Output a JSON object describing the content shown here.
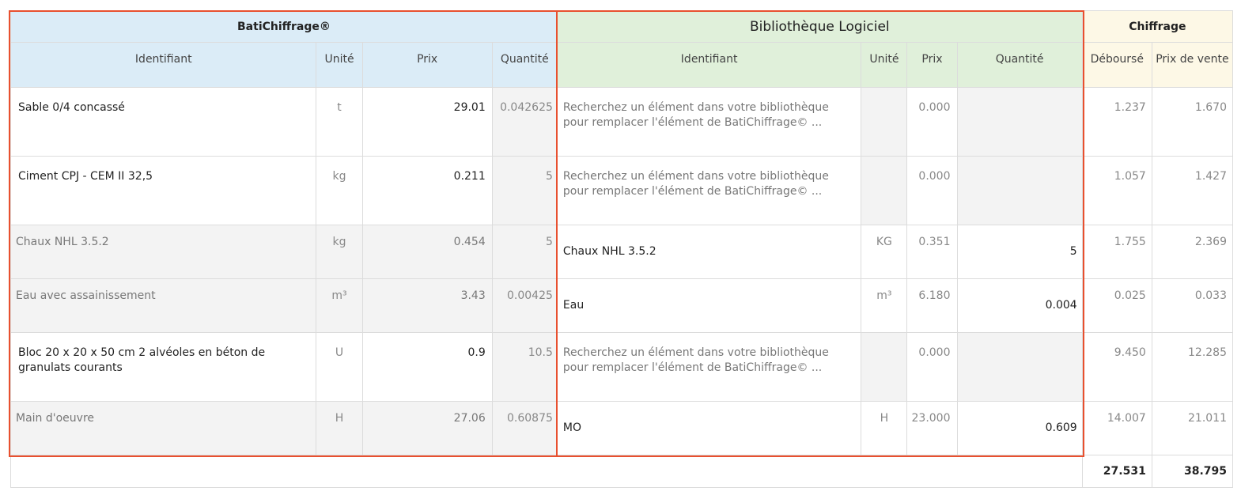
{
  "groups": {
    "bati": "BatiChiffrage®",
    "library": "Bibliothèque Logiciel",
    "chiffrage": "Chiffrage"
  },
  "headers": {
    "bati": [
      "Identifiant",
      "Unité",
      "Prix",
      "Quantité"
    ],
    "library": [
      "Identifiant",
      "Unité",
      "Prix",
      "Quantité"
    ],
    "chiffrage": [
      "Déboursé",
      "Prix de vente"
    ]
  },
  "rows": [
    {
      "bati": {
        "id": "Sable 0/4 concassé",
        "unit": "t",
        "price": "29.01",
        "qty": "0.042625"
      },
      "lib": {
        "id": "Recherchez un élément dans votre bibliothèque pour remplacer l'élément de BatiChiffrage© ...",
        "unit": "",
        "price": "0.000",
        "qty": ""
      },
      "debourse": "1.237",
      "prix_vente": "1.670"
    },
    {
      "bati": {
        "id": "Ciment CPJ - CEM II 32,5",
        "unit": "kg",
        "price": "0.211",
        "qty": "5"
      },
      "lib": {
        "id": "Recherchez un élément dans votre bibliothèque pour remplacer l'élément de BatiChiffrage© ...",
        "unit": "",
        "price": "0.000",
        "qty": ""
      },
      "debourse": "1.057",
      "prix_vente": "1.427"
    },
    {
      "bati": {
        "id": "Chaux NHL 3.5.2",
        "unit": "kg",
        "price": "0.454",
        "qty": "5"
      },
      "lib": {
        "id": "Chaux NHL 3.5.2",
        "unit": "KG",
        "price": "0.351",
        "qty": "5"
      },
      "debourse": "1.755",
      "prix_vente": "2.369"
    },
    {
      "bati": {
        "id": "Eau avec assainissement",
        "unit": "m³",
        "price": "3.43",
        "qty": "0.00425"
      },
      "lib": {
        "id": "Eau",
        "unit": "m³",
        "price": "6.180",
        "qty": "0.004"
      },
      "debourse": "0.025",
      "prix_vente": "0.033"
    },
    {
      "bati": {
        "id": "Bloc 20 x 20 x 50 cm 2 alvéoles en béton de granulats courants",
        "unit": "U",
        "price": "0.9",
        "qty": "10.5"
      },
      "lib": {
        "id": "Recherchez un élément dans votre bibliothèque pour remplacer l'élément de BatiChiffrage© ...",
        "unit": "",
        "price": "0.000",
        "qty": ""
      },
      "debourse": "9.450",
      "prix_vente": "12.285"
    },
    {
      "bati": {
        "id": "Main d'oeuvre",
        "unit": "H",
        "price": "27.06",
        "qty": "0.60875"
      },
      "lib": {
        "id": "MO",
        "unit": "H",
        "price": "23.000",
        "qty": "0.609"
      },
      "debourse": "14.007",
      "prix_vente": "21.011"
    }
  ],
  "totals": {
    "debourse": "27.531",
    "prix_vente": "38.795"
  },
  "colors": {
    "bati_header": "#dbecf7",
    "library_header": "#e0f0da",
    "chiffrage_header": "#fdf8e6",
    "highlight_frame": "#e8502f"
  }
}
